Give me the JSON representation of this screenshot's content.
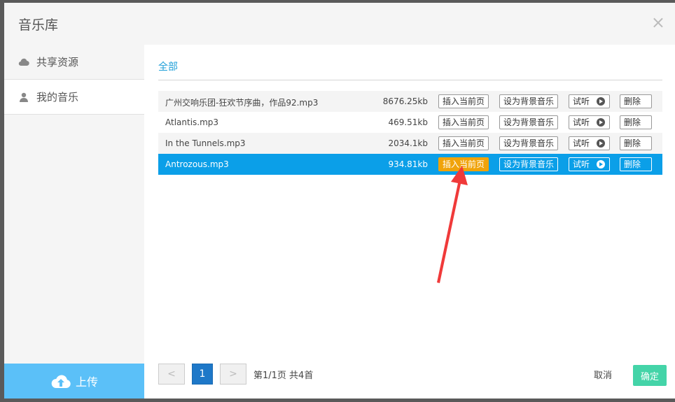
{
  "dialog": {
    "title": "音乐库",
    "close_icon": "×"
  },
  "sidebar": {
    "items": [
      {
        "label": "共享资源",
        "icon": "cloud-icon"
      },
      {
        "label": "我的音乐",
        "icon": "user-icon"
      }
    ],
    "upload_label": "上传"
  },
  "main": {
    "tab_label": "全部",
    "actions": {
      "insert": "插入当前页",
      "set_bg": "设为背景音乐",
      "listen": "试听",
      "delete": "删除"
    },
    "files": [
      {
        "name": "广州交响乐团-狂欢节序曲，作品92.mp3",
        "size": "8676.25kb"
      },
      {
        "name": "Atlantis.mp3",
        "size": "469.51kb"
      },
      {
        "name": "In the Tunnels.mp3",
        "size": "2034.1kb"
      },
      {
        "name": "Antrozous.mp3",
        "size": "934.81kb"
      }
    ]
  },
  "pager": {
    "prev": "<",
    "current": "1",
    "next": ">",
    "info": "第1/1页  共4首"
  },
  "footer": {
    "cancel": "取消",
    "confirm": "确定"
  },
  "colors": {
    "selected_row": "#0b9fe8",
    "insert_highlight": "#f0a30a",
    "confirm": "#44d4a8",
    "annotation_arrow": "#f03a3a"
  }
}
